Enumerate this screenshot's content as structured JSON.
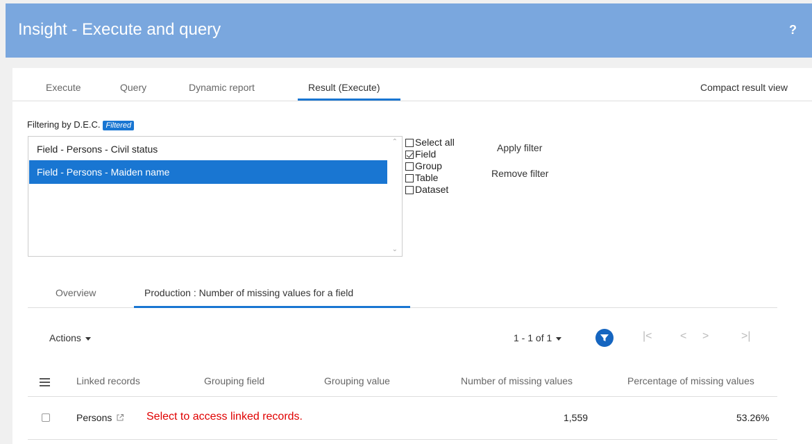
{
  "window": {
    "title": "Insight - Execute and query",
    "help": "?"
  },
  "tabs": [
    "Execute",
    "Query",
    "Dynamic report",
    "Result (Execute)"
  ],
  "compact_view": "Compact result view",
  "filter": {
    "label": "Filtering by D.E.C.",
    "badge": "Filtered",
    "items": [
      "Field - Persons - Civil status",
      "Field - Persons - Maiden name"
    ],
    "selected_index": 1,
    "checkboxes": [
      {
        "label": "Select all",
        "checked": false
      },
      {
        "label": "Field",
        "checked": true
      },
      {
        "label": "Group",
        "checked": false
      },
      {
        "label": "Table",
        "checked": false
      },
      {
        "label": "Dataset",
        "checked": false
      }
    ],
    "apply": "Apply filter",
    "remove": "Remove filter"
  },
  "subtabs": [
    "Overview",
    "Production : Number of missing values for a field"
  ],
  "toolbar": {
    "actions": "Actions",
    "pagination": "1 - 1 of 1"
  },
  "table": {
    "headers": [
      "Linked records",
      "Grouping field",
      "Grouping value",
      "Number of missing values",
      "Percentage of missing values"
    ],
    "rows": [
      {
        "linked": "Persons",
        "hint": "Select to access linked records.",
        "missing": "1,559",
        "percent": "53.26%"
      }
    ]
  },
  "colors": {
    "header": "#7aa7de",
    "accent": "#1976d2",
    "hint": "#e00000"
  }
}
